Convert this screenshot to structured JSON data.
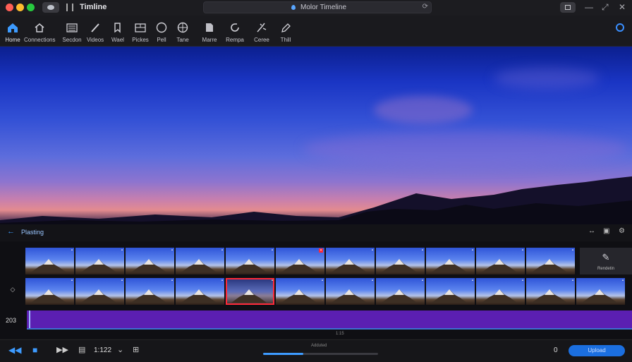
{
  "window": {
    "title": "Timline"
  },
  "search": {
    "text": "Molor Timeline"
  },
  "toolbar": {
    "tools": [
      {
        "label": "Home",
        "icon": "home-icon"
      },
      {
        "label": "Connections",
        "icon": "connections-icon"
      },
      {
        "label": "Secdon",
        "icon": "section-icon"
      },
      {
        "label": "Videos",
        "icon": "pen-icon"
      },
      {
        "label": "Wael",
        "icon": "bookmark-icon"
      },
      {
        "label": "Pickes",
        "icon": "picture-icon"
      },
      {
        "label": "Pell",
        "icon": "circle-icon"
      },
      {
        "label": "Tane",
        "icon": "globe-icon"
      },
      {
        "label": "Marre",
        "icon": "document-icon"
      },
      {
        "label": "Rempa",
        "icon": "refresh-icon"
      },
      {
        "label": "Ceree",
        "icon": "effects-icon"
      },
      {
        "label": "Thill",
        "icon": "pencil-icon"
      }
    ]
  },
  "timeline": {
    "title": "Plasting",
    "track_number": "203",
    "effect_label": "Rendetin",
    "center_label": "1:15"
  },
  "transport": {
    "time": "1:122",
    "progress_label": "Adduted",
    "progress_fraction": 0.35,
    "end_label": "0",
    "upload_label": "Upload"
  },
  "colors": {
    "accent": "#3d9bff",
    "selection": "#ff2a3a",
    "audio": "#5b1fb2"
  }
}
